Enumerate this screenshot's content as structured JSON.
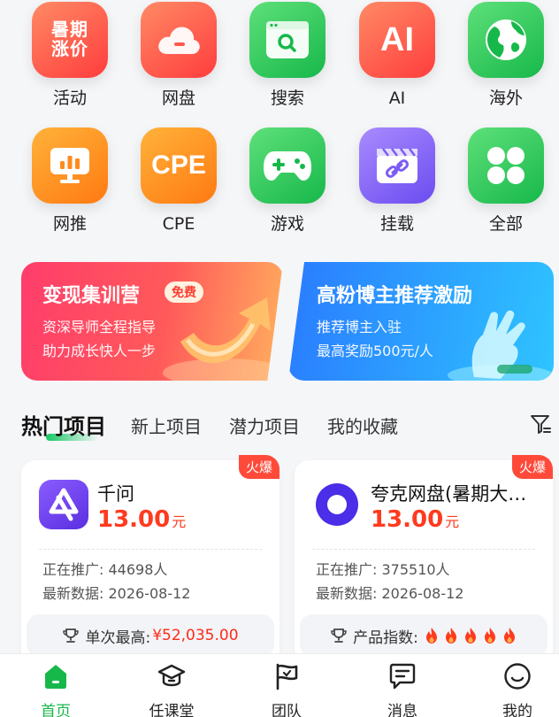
{
  "grid": {
    "items": [
      {
        "label": "活动",
        "icon": "summer-price-icon",
        "tile_text": "暑期涨价"
      },
      {
        "label": "网盘",
        "icon": "cloud-icon"
      },
      {
        "label": "搜索",
        "icon": "search-window-icon"
      },
      {
        "label": "AI",
        "icon": "ai-icon",
        "tile_text": "AI"
      },
      {
        "label": "海外",
        "icon": "globe-icon"
      },
      {
        "label": "网推",
        "icon": "monitor-chart-icon"
      },
      {
        "label": "CPE",
        "icon": "cpe-icon",
        "tile_text": "CPE"
      },
      {
        "label": "游戏",
        "icon": "gamepad-icon"
      },
      {
        "label": "挂载",
        "icon": "link-clapper-icon"
      },
      {
        "label": "全部",
        "icon": "grid-four-icon"
      }
    ]
  },
  "banners": {
    "left": {
      "title": "变现集训营",
      "badge": "免费",
      "line1": "资深导师全程指导",
      "line2": "助力成长快人一步"
    },
    "right": {
      "title": "高粉博主推荐激励",
      "line1": "推荐博主入驻",
      "line2": "最高奖励500元/人"
    }
  },
  "tabs": [
    "热门项目",
    "新上项目",
    "潜力项目",
    "我的收藏"
  ],
  "cards": [
    {
      "badge": "火爆",
      "name": "千问",
      "price": "13.00",
      "unit": "元",
      "promoting": "正在推广: 44698人",
      "latest": "最新数据: 2026-08-12",
      "foot_label": "单次最高:",
      "foot_value": "¥52,035.00"
    },
    {
      "badge": "火爆",
      "name": "夸克网盘(暑期大…",
      "price": "13.00",
      "unit": "元",
      "promoting": "正在推广: 375510人",
      "latest": "最新数据: 2026-08-12",
      "foot_label": "产品指数:",
      "flames": 5
    }
  ],
  "nav": {
    "items": [
      {
        "label": "首页",
        "active": true
      },
      {
        "label": "任课堂"
      },
      {
        "label": "团队"
      },
      {
        "label": "消息"
      },
      {
        "label": "我的"
      }
    ]
  },
  "colors": {
    "accent": "#17b84a",
    "price": "#ff3b1f",
    "hot": "#ff4a3a"
  }
}
